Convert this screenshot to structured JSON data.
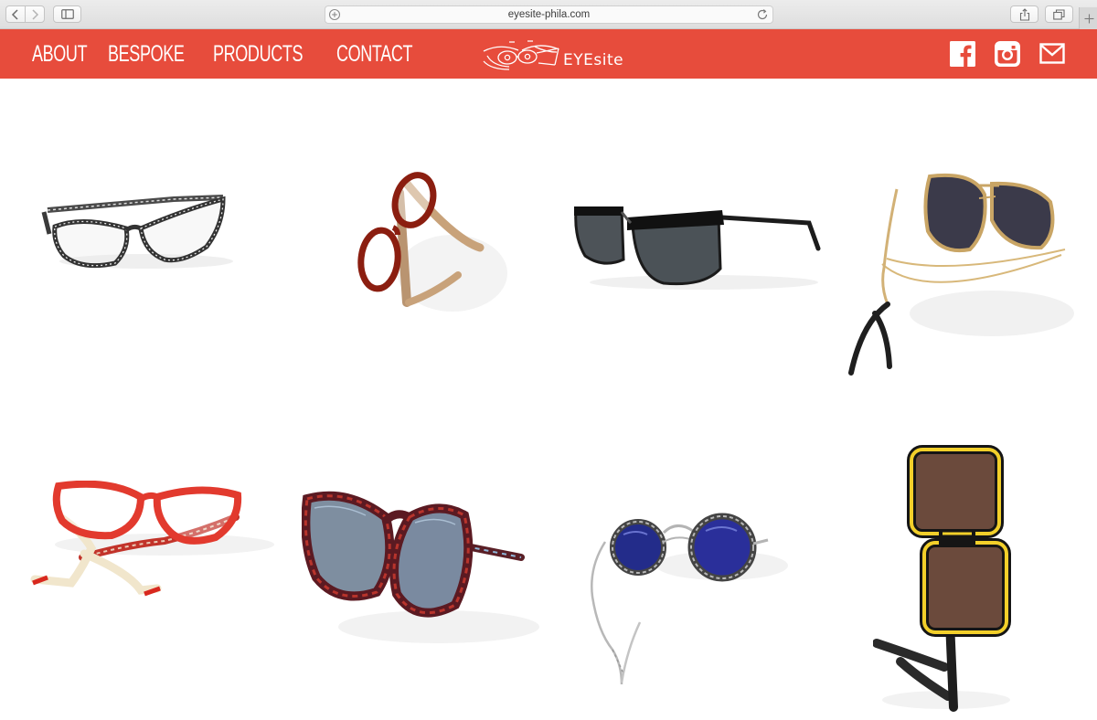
{
  "browser": {
    "url": "eyesite-phila.com",
    "icons": [
      "back-icon",
      "forward-icon",
      "sidebar-icon",
      "site-settings-icon",
      "reload-icon",
      "share-icon",
      "tabs-icon",
      "new-tab-icon"
    ]
  },
  "header": {
    "nav": [
      {
        "label": "ABOUT"
      },
      {
        "label": "BESPOKE"
      },
      {
        "label": "PRODUCTS"
      },
      {
        "label": "CONTACT"
      }
    ],
    "logo_text": "EYEsite",
    "social_icons": [
      "facebook-icon",
      "instagram-icon",
      "mail-icon"
    ]
  },
  "products": [
    {
      "name": "black-white-striped-cat-eye-glasses"
    },
    {
      "name": "tortoise-red-round-glasses"
    },
    {
      "name": "black-half-rim-sunglasses"
    },
    {
      "name": "gold-aviator-sunglasses"
    },
    {
      "name": "red-cat-eye-glasses"
    },
    {
      "name": "red-blue-round-sunglasses"
    },
    {
      "name": "silver-round-blue-lens-sunglasses"
    },
    {
      "name": "yellow-black-square-sunglasses"
    }
  ],
  "colors": {
    "header_bg": "#e74c3c",
    "header_text": "#ffffff",
    "page_bg": "#ffffff"
  }
}
